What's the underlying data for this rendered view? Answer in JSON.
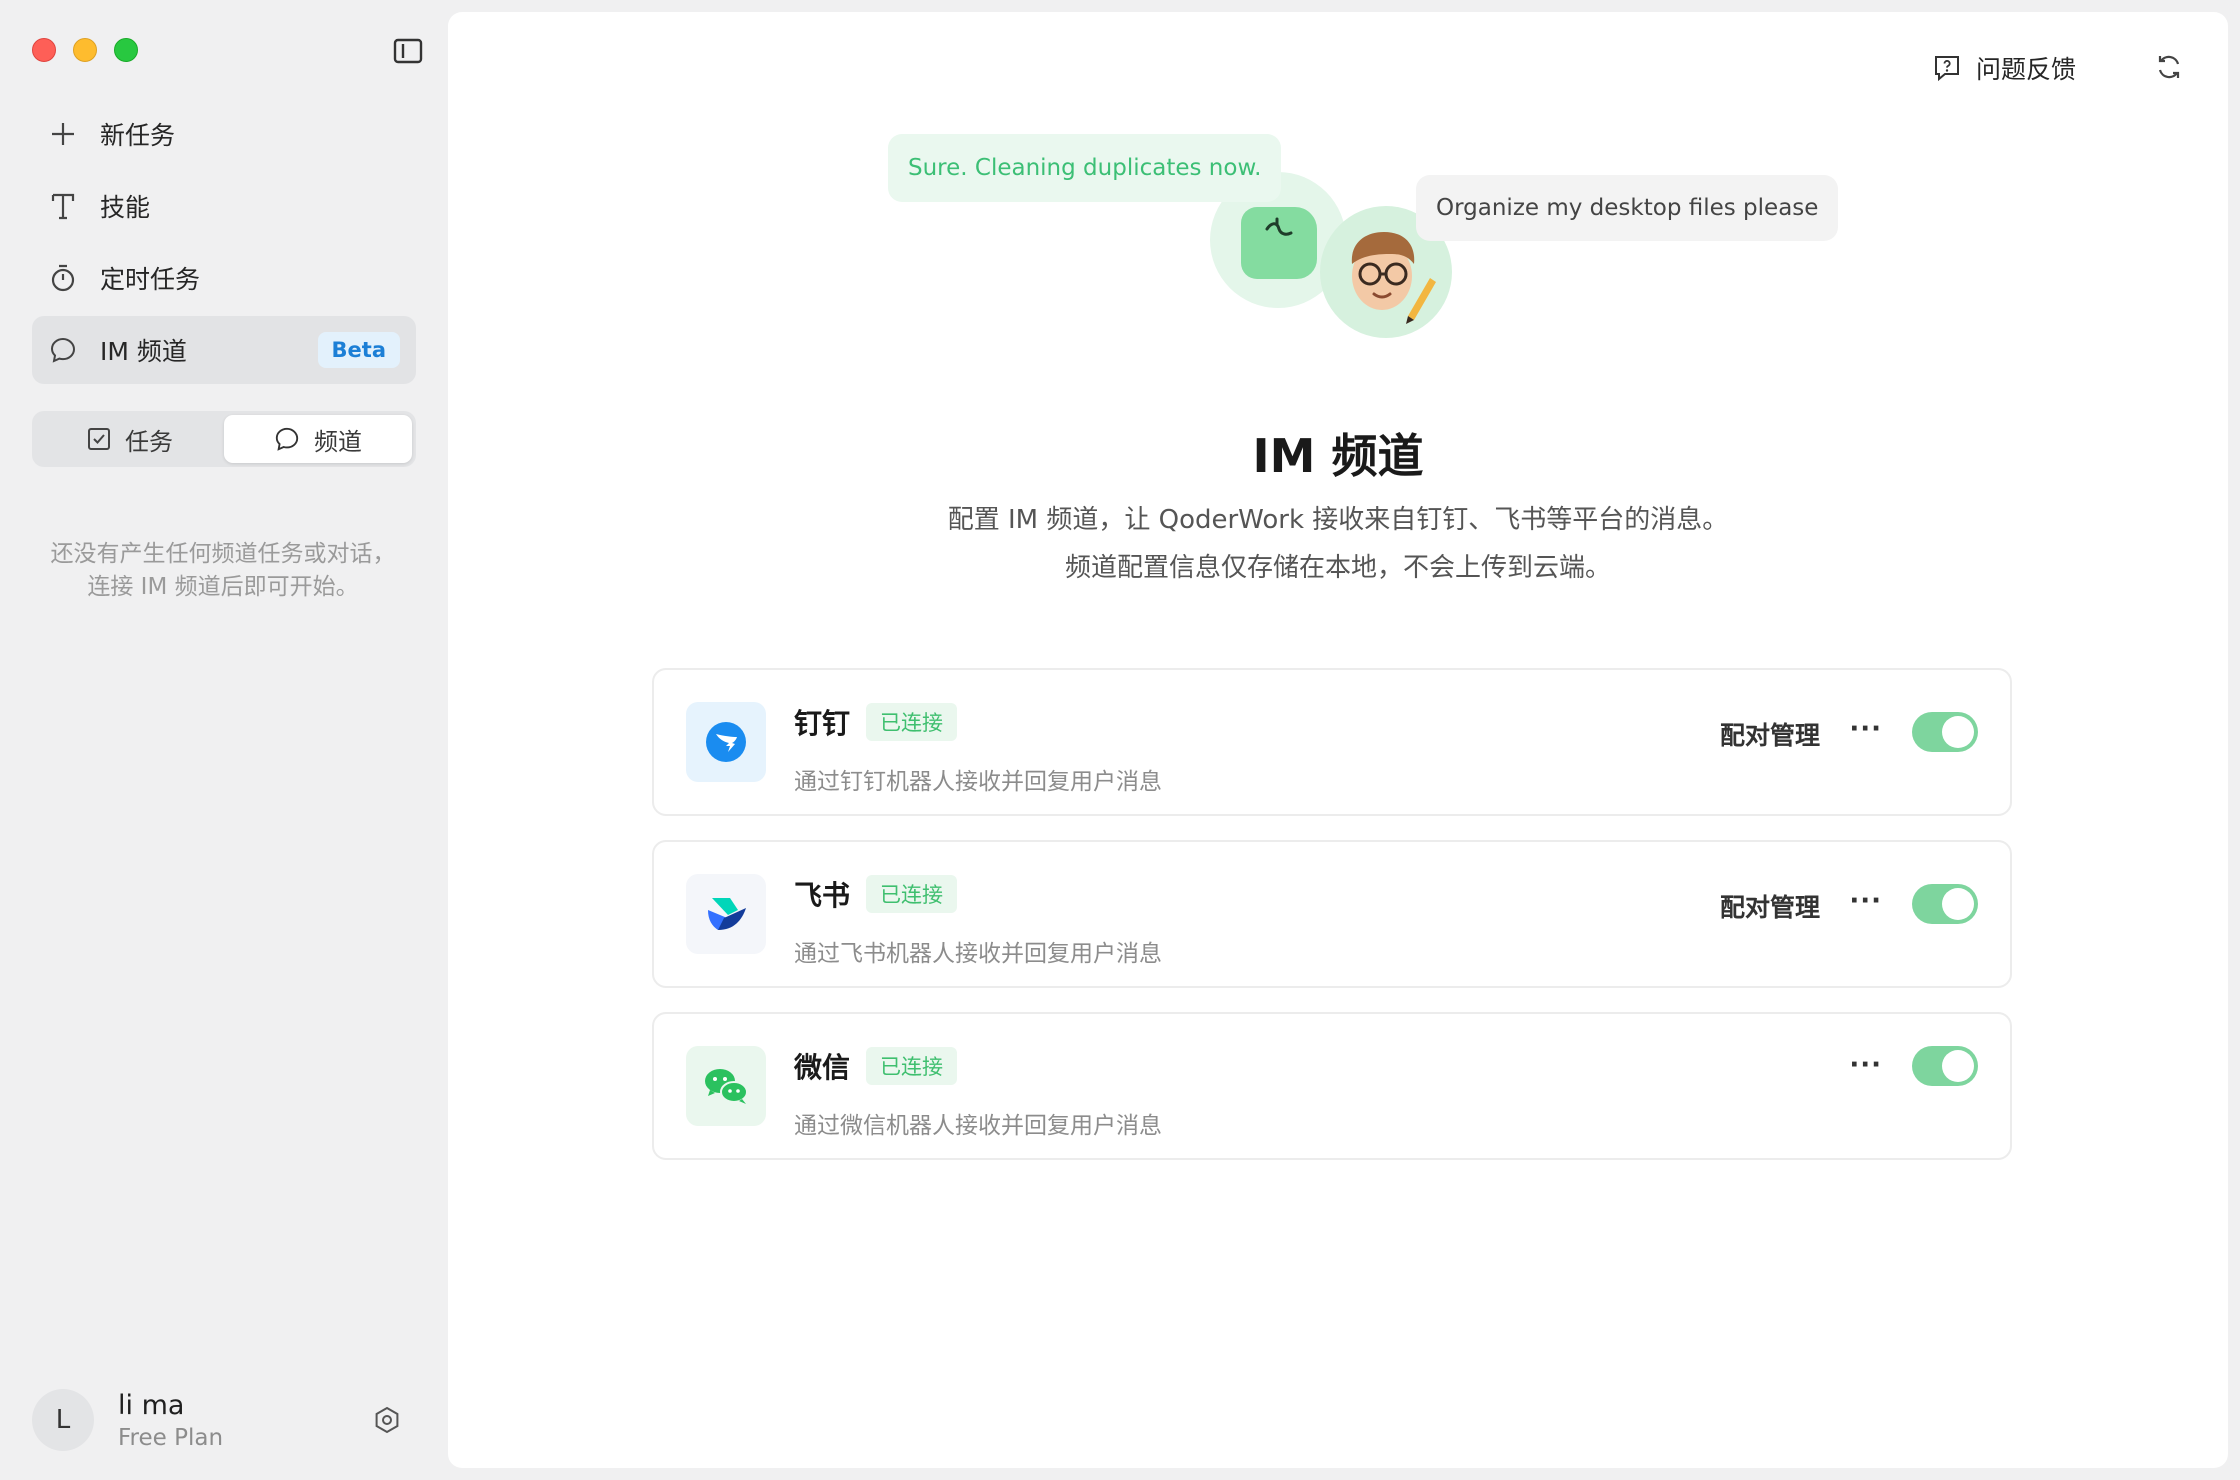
{
  "sidebar": {
    "nav": [
      {
        "label": "新任务",
        "icon": "plus-icon"
      },
      {
        "label": "技能",
        "icon": "skill-icon"
      },
      {
        "label": "定时任务",
        "icon": "timer-icon"
      },
      {
        "label": "IM 频道",
        "icon": "chat-bubble-icon",
        "badge": "Beta",
        "active": true
      }
    ],
    "segment": {
      "tasks_label": "任务",
      "channels_label": "频道",
      "selected": "频道"
    },
    "empty_note": "还没有产生任何频道任务或对话，连接 IM 频道后即可开始。",
    "user": {
      "initial": "L",
      "name": "li ma",
      "plan": "Free Plan"
    }
  },
  "topbar": {
    "feedback_label": "问题反馈"
  },
  "hero": {
    "bubble_ai": "Sure. Cleaning duplicates now.",
    "bubble_user": "Organize my desktop files please",
    "title": "IM 频道",
    "desc_line1": "配置 IM 频道，让 QoderWork 接收来自钉钉、飞书等平台的消息。",
    "desc_line2": "频道配置信息仅存储在本地，不会上传到云端。"
  },
  "channels": [
    {
      "name": "钉钉",
      "status": "已连接",
      "desc": "通过钉钉机器人接收并回复用户消息",
      "pair_label": "配对管理",
      "more": "···",
      "enabled": true,
      "logo_color": "#1a8cf0"
    },
    {
      "name": "飞书",
      "status": "已连接",
      "desc": "通过飞书机器人接收并回复用户消息",
      "pair_label": "配对管理",
      "more": "···",
      "enabled": true,
      "logo_color": "#3370ff"
    },
    {
      "name": "微信",
      "status": "已连接",
      "desc": "通过微信机器人接收并回复用户消息",
      "more": "···",
      "enabled": true,
      "logo_color": "#2bc15f"
    }
  ],
  "colors": {
    "accent_green": "#7ed59e",
    "tag_green": "#3fbf6f",
    "beta_blue": "#1c7fd6"
  }
}
